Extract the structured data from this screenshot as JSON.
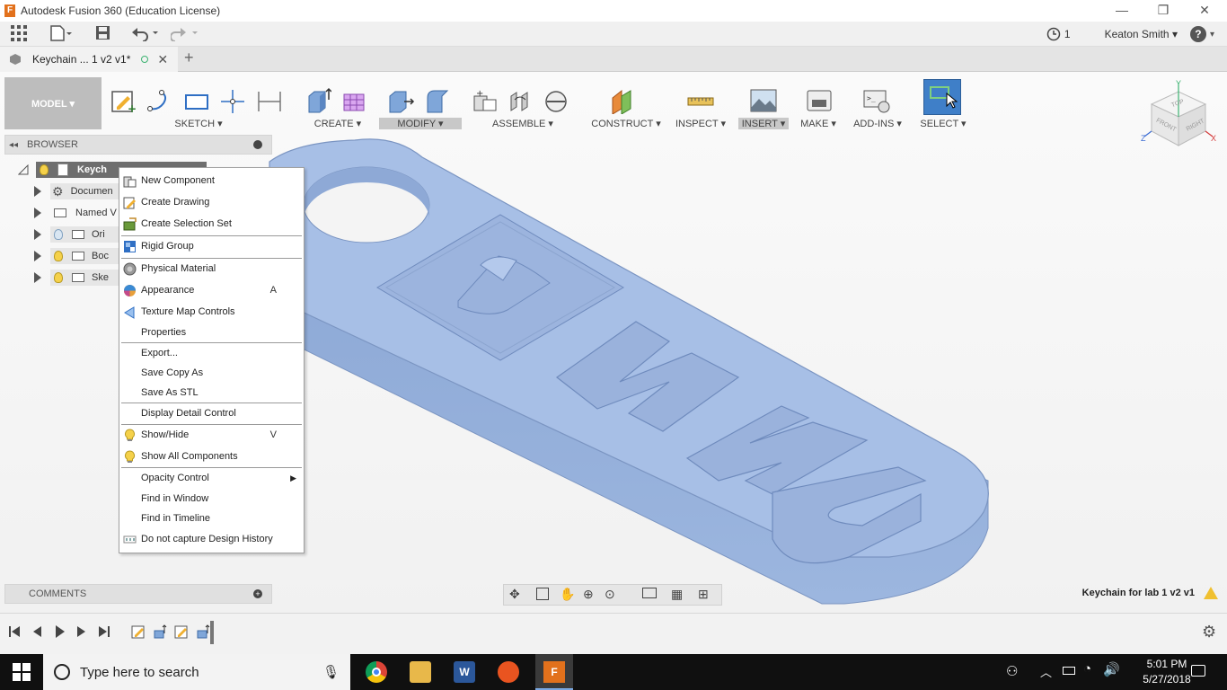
{
  "window": {
    "title": "Autodesk Fusion 360 (Education License)",
    "logo_letter": "F"
  },
  "quickbar": {
    "job_count": "1",
    "user": "Keaton Smith ▾",
    "help": "?"
  },
  "tab": {
    "label": "Keychain ... 1 v2 v1*"
  },
  "toolbar": {
    "workspace": "MODEL ▾",
    "groups": [
      {
        "label": "SKETCH ▾"
      },
      {
        "label": "CREATE ▾"
      },
      {
        "label": "MODIFY ▾"
      },
      {
        "label": "ASSEMBLE ▾"
      },
      {
        "label": "CONSTRUCT ▾"
      },
      {
        "label": "INSPECT ▾"
      },
      {
        "label": "INSERT ▾"
      },
      {
        "label": "MAKE ▾"
      },
      {
        "label": "ADD-INS ▾"
      },
      {
        "label": "SELECT ▾"
      }
    ]
  },
  "viewcube": {
    "top": "TOP",
    "front": "FRONT",
    "right": "RIGHT",
    "axis_x": "X",
    "axis_y": "Y",
    "axis_z": "Z"
  },
  "browser": {
    "title": "BROWSER",
    "root_label": "Keych",
    "items": [
      {
        "label": "Documen"
      },
      {
        "label": "Named V"
      },
      {
        "label": "Ori"
      },
      {
        "label": "Boc"
      },
      {
        "label": "Ske"
      }
    ]
  },
  "context_menu": {
    "items": [
      {
        "label": "New Component",
        "shortcut": ""
      },
      {
        "label": "Create Drawing",
        "shortcut": ""
      },
      {
        "label": "Create Selection Set",
        "shortcut": ""
      },
      {
        "label": "Rigid Group",
        "shortcut": ""
      },
      {
        "label": "Physical Material",
        "shortcut": ""
      },
      {
        "label": "Appearance",
        "shortcut": "A"
      },
      {
        "label": "Texture Map Controls",
        "shortcut": ""
      },
      {
        "label": "Properties",
        "shortcut": ""
      },
      {
        "label": "Export...",
        "shortcut": ""
      },
      {
        "label": "Save Copy As",
        "shortcut": ""
      },
      {
        "label": "Save As STL",
        "shortcut": ""
      },
      {
        "label": "Display Detail Control",
        "shortcut": ""
      },
      {
        "label": "Show/Hide",
        "shortcut": "V"
      },
      {
        "label": "Show All Components",
        "shortcut": ""
      },
      {
        "label": "Opacity Control",
        "shortcut": ""
      },
      {
        "label": "Find in Window",
        "shortcut": ""
      },
      {
        "label": "Find in Timeline",
        "shortcut": ""
      },
      {
        "label": "Do not capture Design History",
        "shortcut": ""
      }
    ]
  },
  "model": {
    "text": "NYU",
    "color": "#9fb8e0"
  },
  "comments": {
    "title": "COMMENTS"
  },
  "status": {
    "document_name": "Keychain for lab 1 v2 v1"
  },
  "taskbar": {
    "search_placeholder": "Type here to search",
    "time": "5:01 PM",
    "date": "5/27/2018"
  }
}
